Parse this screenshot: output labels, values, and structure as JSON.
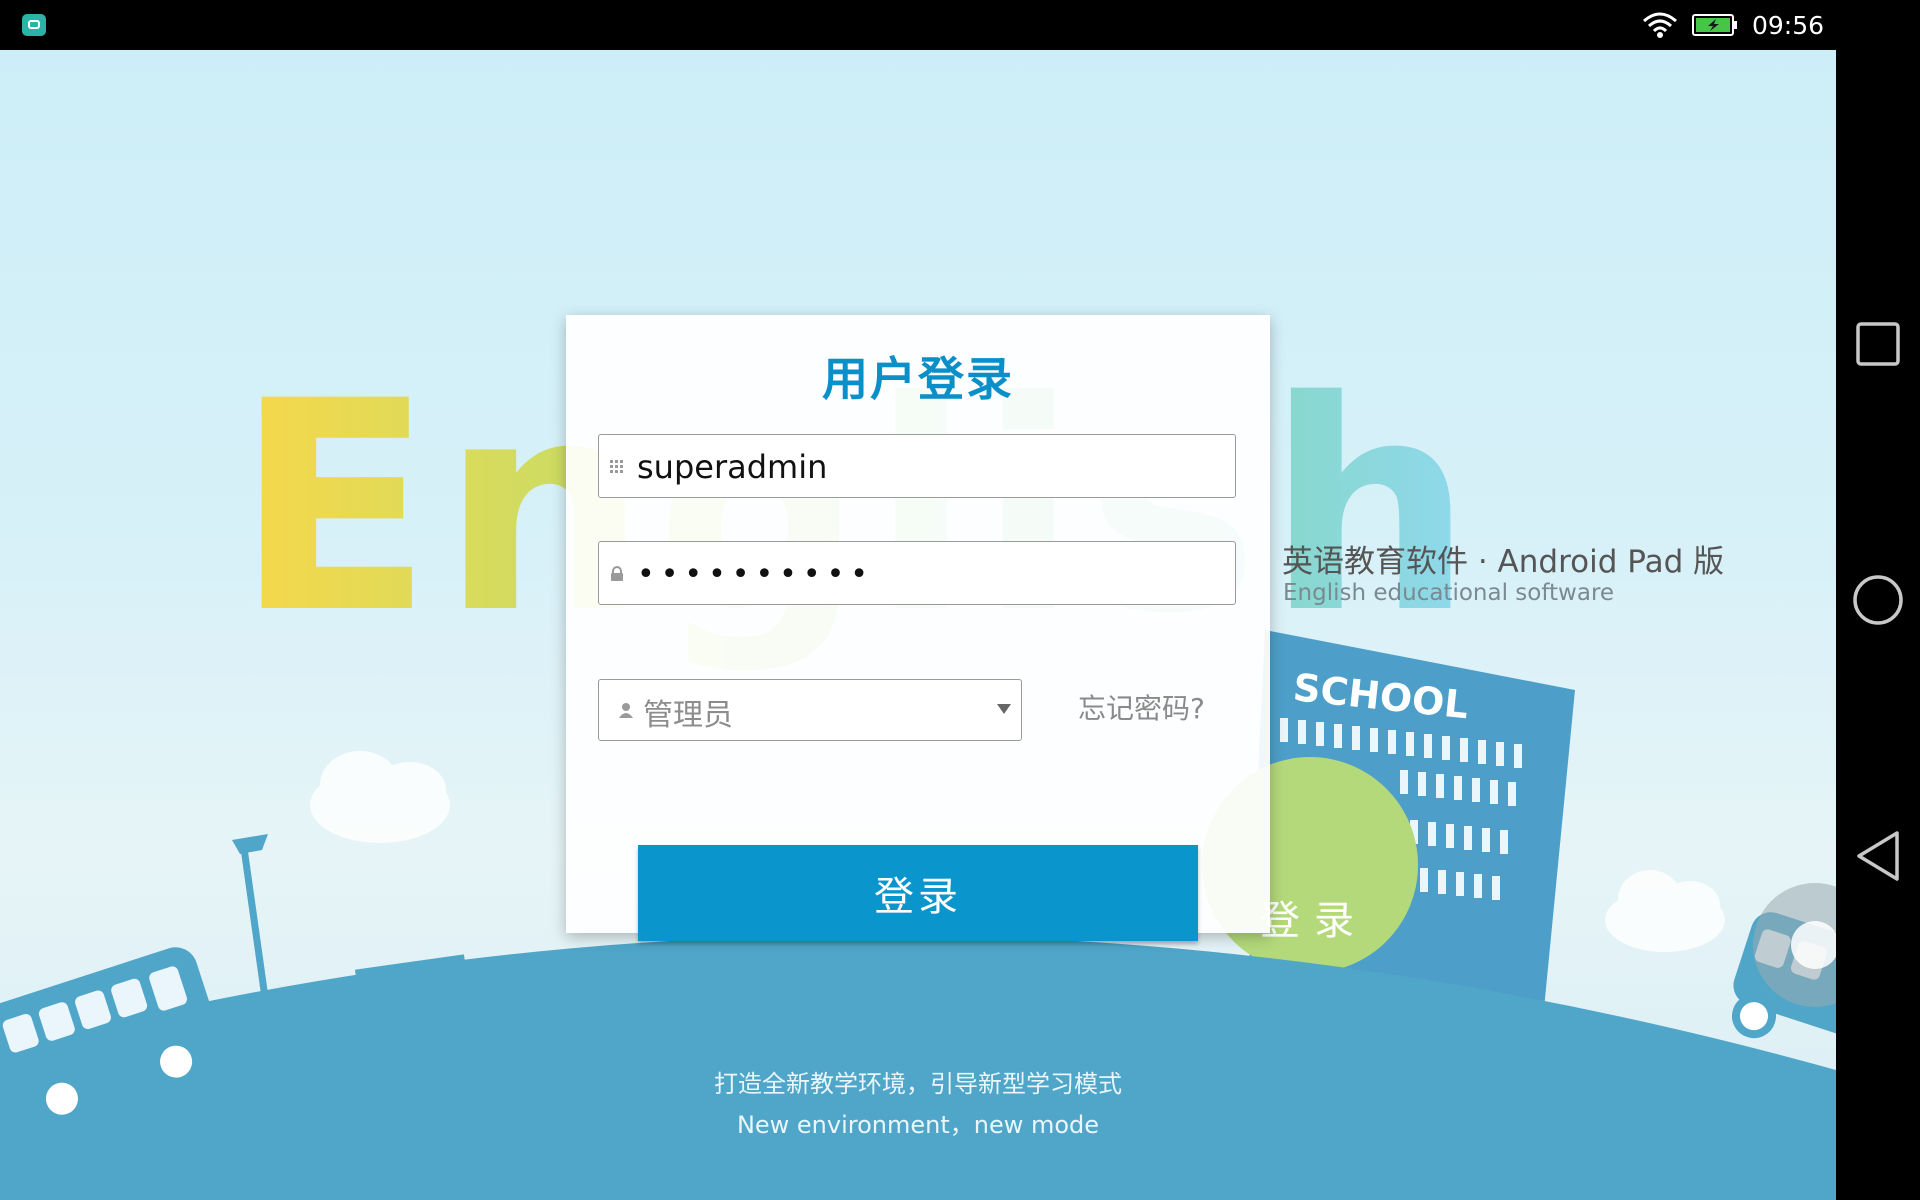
{
  "status_bar": {
    "app_icon": "android-app-icon",
    "wifi_icon": "wifi-icon",
    "battery_icon": "battery-charging-icon",
    "time": "09:56"
  },
  "nav_bar": {
    "recent_icon": "square-recent-apps-icon",
    "home_icon": "circle-home-icon",
    "back_icon": "triangle-back-icon"
  },
  "background": {
    "logo_text": "English",
    "tagline_cn": "英语教育软件 · Android Pad 版",
    "tagline_en": "English educational software",
    "school_sign": "SCHOOL",
    "circle_login_label": "登录",
    "bottom_slogan_cn": "打造全新教学环境，引导新型学习模式",
    "bottom_slogan_en": "New environment，new mode"
  },
  "login_dialog": {
    "title": "用户登录",
    "username_value": "superadmin",
    "password_value": "••••••••••",
    "role_selected": "管理员",
    "forgot_password": "忘记密码?",
    "login_button": "登录"
  },
  "colors": {
    "accent": "#0a95cd",
    "ground": "#4fa6c9",
    "green_circle": "#b4d97b"
  }
}
